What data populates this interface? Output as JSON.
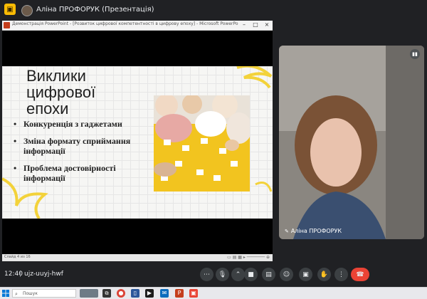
{
  "meet": {
    "presenter_title": "Аліна ПРОФОРУК (Презентація)",
    "clock": "12:40",
    "separator": "|",
    "meeting_code": "ujz-uuyj-hwf",
    "participant_name": "Аліна ПРОФОРУК"
  },
  "powerpoint": {
    "window_title": "Демонстрація PowerPoint - [Розвиток цифрової компетентності в цифрову епоху] - Microsoft PowerPoint (Сбой акт...",
    "status_text": "Слайд 4 из 16"
  },
  "slide": {
    "title": "Виклики\nцифрової\nепохи",
    "bullets": [
      "Конкуренція з гаджетами",
      "Зміна формату сприймання інформації",
      "Проблема достовірності інформації"
    ]
  },
  "taskbar": {
    "search_placeholder": "Пошук"
  },
  "colors": {
    "meet_background": "#202124",
    "slide_accent": "#f3c521",
    "hangup": "#ea4335",
    "presentation_icon": "#fbbc04"
  },
  "icons": [
    "presentation-icon",
    "mic-icon",
    "camera-icon",
    "captions-icon",
    "emoji-icon",
    "present-icon",
    "raise-hand-icon",
    "more-icon",
    "hangup-icon",
    "windows-logo-icon",
    "search-icon",
    "chrome-icon",
    "powerpoint-icon"
  ]
}
